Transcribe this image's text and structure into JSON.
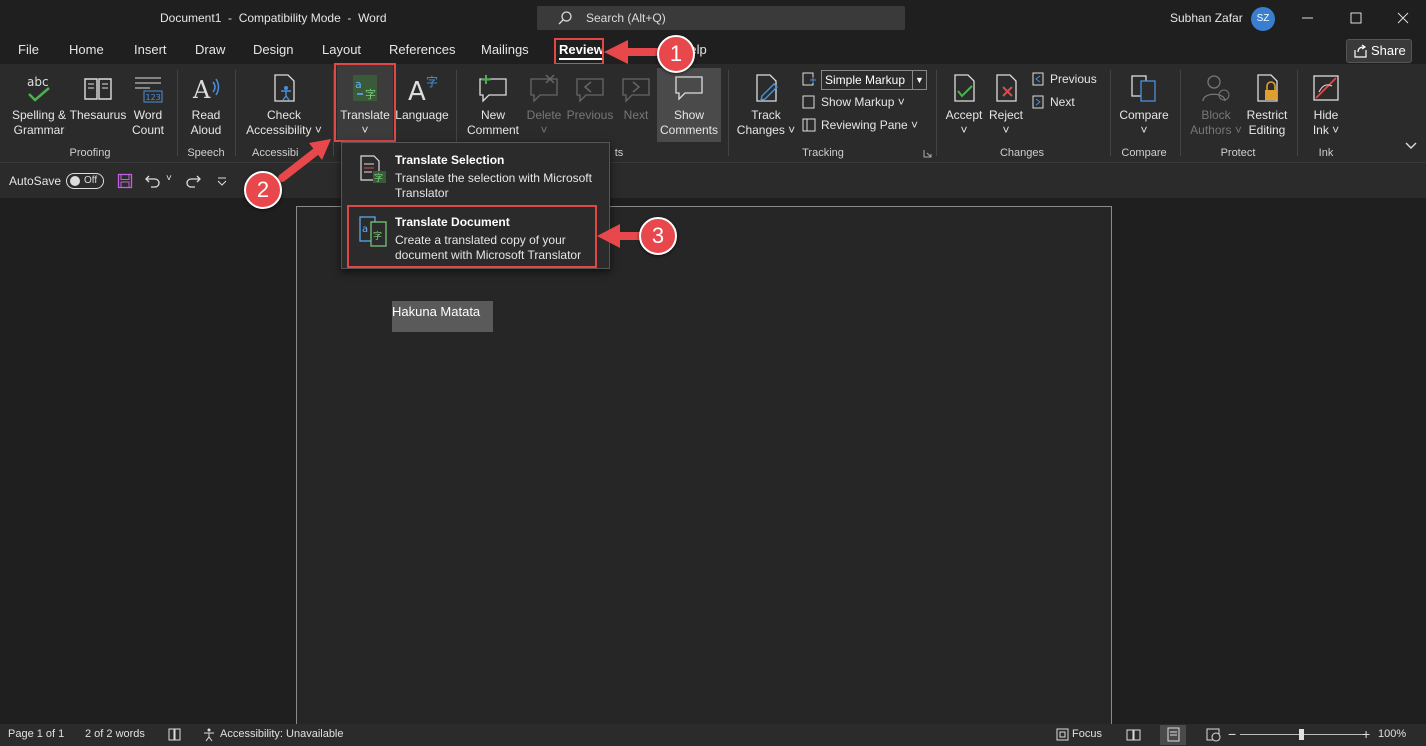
{
  "window": {
    "title": "Document1  -  Compatibility Mode  -  Word",
    "search_placeholder": "Search (Alt+Q)",
    "user_name": "Subhan Zafar",
    "user_initials": "SZ"
  },
  "tabs": [
    "File",
    "Home",
    "Insert",
    "Draw",
    "Design",
    "Layout",
    "References",
    "Mailings",
    "Review",
    "Help"
  ],
  "active_tab": "Review",
  "share_label": "Share",
  "ribbon": {
    "proofing": {
      "spelling": [
        "Spelling &",
        "Grammar"
      ],
      "thesaurus": "Thesaurus",
      "word_count": [
        "Word",
        "Count"
      ],
      "label": "Proofing"
    },
    "speech": {
      "read_aloud": [
        "Read",
        "Aloud"
      ],
      "label": "Speech"
    },
    "accessibility": {
      "check": [
        "Check",
        "Accessibility ˅"
      ],
      "label": "Accessibi"
    },
    "language": {
      "translate": "Translate",
      "language": "Language"
    },
    "comments": {
      "new": [
        "New",
        "Comment"
      ],
      "delete": "Delete",
      "previous": "Previous",
      "next": "Next",
      "show": [
        "Show",
        "Comments"
      ],
      "label_fragment": "ts"
    },
    "tracking": {
      "track_changes": [
        "Track",
        "Changes ˅"
      ],
      "markup_select": "Simple Markup",
      "show_markup": "Show Markup ˅",
      "reviewing_pane": "Reviewing Pane  ˅",
      "label": "Tracking"
    },
    "changes": {
      "accept": "Accept",
      "reject": "Reject",
      "previous": "Previous",
      "next": "Next",
      "label": "Changes"
    },
    "compare": {
      "compare": "Compare",
      "label": "Compare"
    },
    "protect": {
      "block_authors": [
        "Block",
        "Authors ˅"
      ],
      "restrict_editing": [
        "Restrict",
        "Editing"
      ],
      "label": "Protect"
    },
    "ink": {
      "hide_ink": [
        "Hide",
        "Ink ˅"
      ],
      "label": "Ink"
    }
  },
  "qat": {
    "autosave": "AutoSave",
    "toggle": "Off"
  },
  "translate_menu": {
    "items": [
      {
        "title": "Translate Selection",
        "desc": "Translate the selection with Microsoft Translator"
      },
      {
        "title": "Translate Document",
        "desc": "Create a translated copy of your document with Microsoft Translator"
      }
    ]
  },
  "document": {
    "selected_text": "Hakuna Matata"
  },
  "annotations": [
    "1",
    "2",
    "3"
  ],
  "status": {
    "page": "Page 1 of 1",
    "words": "2 of 2 words",
    "accessibility": "Accessibility: Unavailable",
    "focus": "Focus",
    "zoom": "100%"
  },
  "colors": {
    "accent_red": "#e8484c",
    "avatar_blue": "#3a7fcf",
    "ribbon_bg": "#2b2b2b",
    "window_bg": "#1f1f1f"
  }
}
